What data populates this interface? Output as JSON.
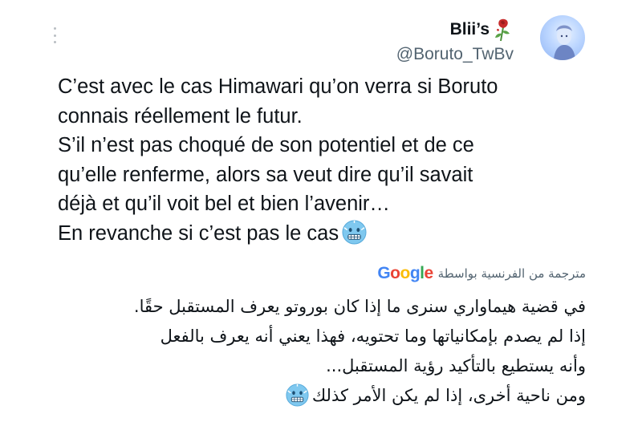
{
  "tweet": {
    "author": {
      "display_name": "Blii’s",
      "name_emoji": "wilted-rose-emoji",
      "handle": "@Boruto_TwBv",
      "avatar": "avatar-icon"
    },
    "more_icon": "more-options-icon",
    "text_lines": [
      "C’est avec le cas Himawari qu’on verra si Boruto",
      "connais réellement le futur.",
      "S’il n’est pas choqué de son potentiel et de ce",
      "qu’elle renferme, alors sa veut dire qu’il savait",
      "déjà et qu’il voit bel et bien l’avenir…",
      "En revanche si c’est pas le cas"
    ],
    "text_emoji": "cold-face-emoji",
    "translation": {
      "label": "مترجمة من الفرنسية بواسطة",
      "provider": "Google",
      "lines": [
        "في قضية هيماواري سنرى ما إذا كان بوروتو يعرف المستقبل حقًا.",
        "إذا لم يصدم بإمكانياتها وما تحتويه، فهذا يعني أنه يعرف بالفعل",
        "وأنه يستطيع بالتأكيد رؤية المستقبل...",
        "ومن ناحية أخرى، إذا لم يكن الأمر كذلك"
      ]
    }
  },
  "colors": {
    "text": "#0f1419",
    "secondary": "#536471",
    "background": "#ffffff"
  }
}
